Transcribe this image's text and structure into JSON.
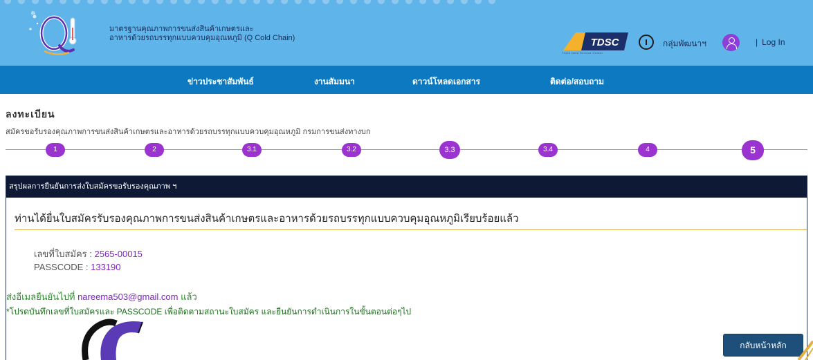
{
  "header": {
    "title_line1": "มาตรฐานคุณภาพการขนส่งสินค้าเกษตรและ",
    "title_line2": "อาหารด้วยรถบรรทุกแบบควบคุมอุณหภูมิ (Q Cold Chain)",
    "tdsc_label": "TDSC",
    "tdsc_sub": "Truck Data Service Center",
    "dev_group": "กลุ่มพัฒนาฯ",
    "login_sep": "|",
    "login_label": "Log In",
    "logo_letter": "Q"
  },
  "nav": {
    "items": [
      "ข่าวประชาสัมพันธ์",
      "งานสัมมนา",
      "ดาวน์โหลดเอกสาร",
      "ติดต่อ/สอบถาม"
    ]
  },
  "register": {
    "title": "ลงทะเบียน",
    "subtitle": "สมัครขอรับรองคุณภาพการขนส่งสินค้าเกษตรและอาหารด้วยรถบรรทุกแบบควบคุมอุณหภูมิ กรมการขนส่งทางบก"
  },
  "stepper": {
    "steps": [
      "1",
      "2",
      "3.1",
      "3.2",
      "3.3",
      "3.4",
      "4",
      "5"
    ],
    "current": "5"
  },
  "panel": {
    "header": "สรุปผลการยืนยันการส่งใบสมัครขอรับรองคุณภาพ ฯ",
    "message": "ท่านได้ยื่นใบสมัครรับรองคุณภาพการขนส่งสินค้าเกษตรและอาหารด้วยรถบรรทุกแบบควบคุมอุณหภูมิเรียบร้อยแล้ว",
    "app_no_label": "เลขที่ใบสมัคร :",
    "app_no": "2565-00015",
    "passcode_label": "PASSCODE :",
    "passcode": "133190",
    "email_prefix": "ส่งอีเมลยืนยันไปที่",
    "email": "nareema503@gmail.com",
    "email_suffix": "แล้ว",
    "note": "*โปรดบันทึกเลขที่ใบสมัครและ PASSCODE เพื่อติดตามสถานะใบสมัคร และยืนยันการดำเนินการในขั้นตอนต่อๆไป",
    "home_button": "กลับหน้าหลัก"
  },
  "colors": {
    "header_bg": "#5fb4ea",
    "nav_bg": "#0d79c1",
    "step_purple": "#9b33d1",
    "panel_head_bg": "#0d1935",
    "button_bg": "#1e4f7a"
  }
}
